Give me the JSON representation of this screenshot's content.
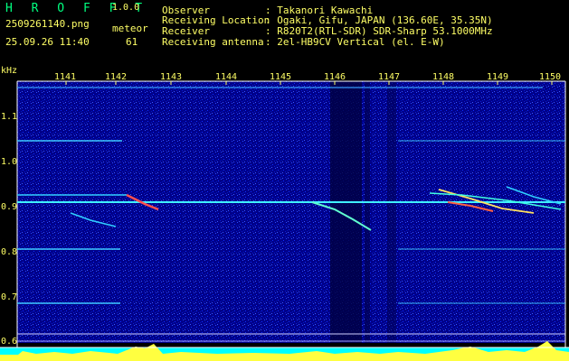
{
  "app": {
    "name": "H R O F F T",
    "version": "1.0.0"
  },
  "file": {
    "name": "2509261140.png",
    "datetime": "25.09.26 11:40"
  },
  "meteor": {
    "label": "meteor",
    "count": "61"
  },
  "info": [
    {
      "key": "Observer",
      "value": ": Takanori Kawachi"
    },
    {
      "key": "Receiving Location",
      "value": ": Ogaki, Gifu, JAPAN (136.60E, 35.35N)"
    },
    {
      "key": "Receiver",
      "value": ": R820T2(RTL-SDR) SDR-Sharp 53.1000MHz"
    },
    {
      "key": "Receiving antenna",
      "value": ": 2el-HB9CV Vertical (el. E-W)"
    }
  ],
  "axes": {
    "y_unit": "kHz",
    "y_ticks": [
      "1.1",
      "1.0",
      "0.9",
      "0.8",
      "0.7",
      "0.6"
    ],
    "x_ticks": [
      "1141",
      "1142",
      "1143",
      "1144",
      "1145",
      "1146",
      "1147",
      "1148",
      "1149",
      "1150"
    ]
  },
  "colors": {
    "text": "#ffff66",
    "title": "#00ff80",
    "background": "#00008a",
    "signal": "#00e8ff",
    "hot": "#ff4040"
  }
}
